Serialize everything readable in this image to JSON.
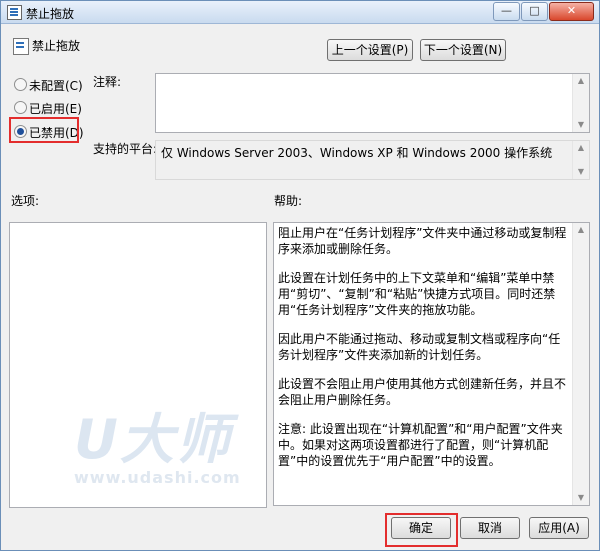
{
  "window": {
    "title": "禁止拖放",
    "minimize_glyph": "—",
    "maximize_glyph": "□",
    "close_glyph": "✕"
  },
  "policy": {
    "name": "禁止拖放"
  },
  "nav": {
    "prev_label": "上一个设置(P)",
    "next_label": "下一个设置(N)"
  },
  "options": [
    {
      "label": "未配置(C)",
      "checked": false
    },
    {
      "label": "已启用(E)",
      "checked": false
    },
    {
      "label": "已禁用(D)",
      "checked": true
    }
  ],
  "comment": {
    "label": "注释:",
    "value": ""
  },
  "platform": {
    "label": "支持的平台:",
    "value": "仅 Windows Server 2003、Windows XP 和 Windows 2000 操作系统"
  },
  "options_section": {
    "label": "选项:"
  },
  "help_section": {
    "label": "帮助:",
    "paragraphs": [
      "阻止用户在“任务计划程序”文件夹中通过移动或复制程序来添加或删除任务。",
      "此设置在计划任务中的上下文菜单和“编辑”菜单中禁用“剪切”、“复制”和“粘贴”快捷方式项目。同时还禁用“任务计划程序”文件夹的拖放功能。",
      "因此用户不能通过拖动、移动或复制文档或程序向“任务计划程序”文件夹添加新的计划任务。",
      "此设置不会阻止用户使用其他方式创建新任务，并且不会阻止用户删除任务。",
      "注意: 此设置出现在“计算机配置”和“用户配置”文件夹中。如果对这两项设置都进行了配置，则“计算机配置”中的设置优先于“用户配置”中的设置。"
    ]
  },
  "footer": {
    "ok_label": "确定",
    "cancel_label": "取消",
    "apply_label": "应用(A)"
  },
  "watermark": {
    "logo": "U大师",
    "url": "www.udashi.com"
  },
  "colors": {
    "highlight": "#e32d2d",
    "title_gradient": "#c9dbef"
  }
}
